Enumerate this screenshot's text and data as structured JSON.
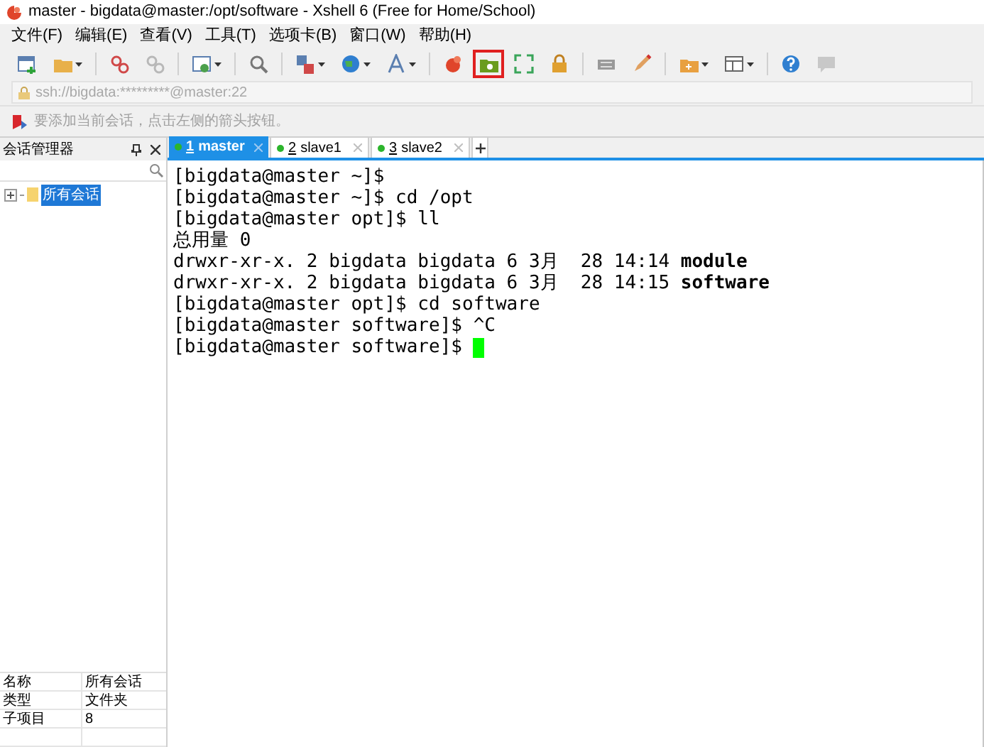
{
  "window": {
    "title": "master - bigdata@master:/opt/software - Xshell 6 (Free for Home/School)"
  },
  "menu": [
    "文件(F)",
    "编辑(E)",
    "查看(V)",
    "工具(T)",
    "选项卡(B)",
    "窗口(W)",
    "帮助(H)"
  ],
  "toolbar": [
    {
      "kind": "new",
      "highlighted": false
    },
    {
      "kind": "open",
      "highlighted": false
    },
    {
      "kind": "sep"
    },
    {
      "kind": "connect",
      "highlighted": false
    },
    {
      "kind": "disconnect",
      "highlighted": false
    },
    {
      "kind": "sep"
    },
    {
      "kind": "newtab",
      "highlighted": false
    },
    {
      "kind": "sep"
    },
    {
      "kind": "find",
      "highlighted": false
    },
    {
      "kind": "sep"
    },
    {
      "kind": "transfer",
      "highlighted": false
    },
    {
      "kind": "globe",
      "highlighted": false
    },
    {
      "kind": "font",
      "highlighted": false
    },
    {
      "kind": "sep"
    },
    {
      "kind": "xshell",
      "highlighted": false
    },
    {
      "kind": "xftp",
      "highlighted": true
    },
    {
      "kind": "fullscreen",
      "highlighted": false
    },
    {
      "kind": "lock",
      "highlighted": false
    },
    {
      "kind": "sep"
    },
    {
      "kind": "keyboard",
      "highlighted": false
    },
    {
      "kind": "pen",
      "highlighted": false
    },
    {
      "kind": "sep"
    },
    {
      "kind": "folder",
      "highlighted": false
    },
    {
      "kind": "layout",
      "highlighted": false
    },
    {
      "kind": "sep"
    },
    {
      "kind": "help",
      "highlighted": false
    },
    {
      "kind": "chat",
      "highlighted": false
    }
  ],
  "address": "ssh://bigdata:*********@master:22",
  "hint": "要添加当前会话，点击左侧的箭头按钮。",
  "session_manager": {
    "title": "会话管理器",
    "tree": [
      {
        "label": "所有会话",
        "selected": true,
        "expanded": false
      }
    ],
    "properties": [
      {
        "name": "名称",
        "value": "所有会话"
      },
      {
        "name": "类型",
        "value": "文件夹"
      },
      {
        "name": "子项目",
        "value": "8"
      }
    ]
  },
  "tabs": [
    {
      "number": "1",
      "label": "master",
      "selected": true
    },
    {
      "number": "2",
      "label": "slave1",
      "selected": false
    },
    {
      "number": "3",
      "label": "slave2",
      "selected": false
    }
  ],
  "terminal": [
    {
      "text": "[bigdata@master ~]$",
      "cursor": false
    },
    {
      "text": "[bigdata@master ~]$ cd /opt",
      "cursor": false
    },
    {
      "text": "[bigdata@master opt]$ ll",
      "cursor": false
    },
    {
      "text": "总用量 0",
      "cursor": false
    },
    {
      "text": "drwxr-xr-x. 2 bigdata bigdata 6 3月  28 14:14 **module**",
      "cursor": false
    },
    {
      "text": "drwxr-xr-x. 2 bigdata bigdata 6 3月  28 14:15 **software**",
      "cursor": false
    },
    {
      "text": "[bigdata@master opt]$ cd software",
      "cursor": false
    },
    {
      "text": "[bigdata@master software]$ ^C",
      "cursor": false
    },
    {
      "text": "[bigdata@master software]$ ",
      "cursor": true
    }
  ]
}
